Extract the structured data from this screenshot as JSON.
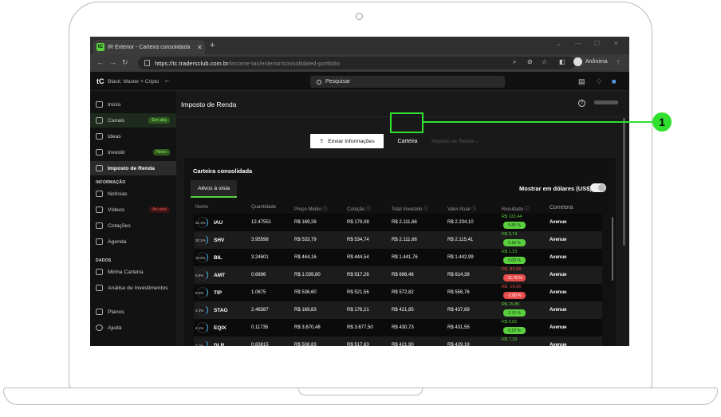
{
  "browser": {
    "tab_title": "IR Exterior - Carteira consolidada",
    "favicon_text": "tC",
    "url_host": "https://tc.tradersclub.com.br",
    "url_path": "/income-tax/exterior/consolidated-portfolio",
    "profile_label": "Anônima"
  },
  "app": {
    "logo": "tC",
    "plan": "Black: Master + Cripto",
    "search_placeholder": "Pesquisar",
    "page_title": "Imposto de Renda"
  },
  "sidebar": {
    "items": [
      {
        "label": "Início",
        "icon": "home-icon"
      },
      {
        "label": "Canais",
        "icon": "hash-icon",
        "badge": "Em alta"
      },
      {
        "label": "Ideas",
        "icon": "bulb-icon"
      },
      {
        "label": "Investir",
        "icon": "invest-icon",
        "badge": "Novo"
      },
      {
        "label": "Imposto de Renda",
        "icon": "tax-icon"
      }
    ],
    "section_informacao": "INFORMAÇÃO",
    "info_items": [
      {
        "label": "Notícias",
        "icon": "news-icon"
      },
      {
        "label": "Vídeos",
        "icon": "video-icon",
        "badge": "Ao vivo"
      },
      {
        "label": "Cotações",
        "icon": "quotes-icon"
      },
      {
        "label": "Agenda",
        "icon": "calendar-icon"
      }
    ],
    "section_dados": "DADOS",
    "data_items": [
      {
        "label": "Minha Carteira",
        "icon": "wallet-icon"
      },
      {
        "label": "Análise de Investimentos",
        "icon": "grid-icon"
      }
    ],
    "bottom_items": [
      {
        "label": "Planos",
        "icon": "cart-icon"
      },
      {
        "label": "Ajuda",
        "icon": "help-icon"
      }
    ]
  },
  "actions": {
    "enviar": "Enviar Informações",
    "carteira": "Carteira",
    "imposto_tab": "Imposto de Renda"
  },
  "card": {
    "title": "Carteira consolidada",
    "subtab": "Ativos à vista",
    "toggle_label": "Mostrar em dólares (US$)"
  },
  "table": {
    "headers": [
      "Nome",
      "Quantidade",
      "Preço Médio ⓘ",
      "Cotação ⓘ",
      "Total Investido ⓘ",
      "Valor Atual ⓘ",
      "Resultado ⓘ",
      "Corretora"
    ],
    "rows": [
      {
        "pct": "21.4%",
        "ticker": "IAU",
        "qty": "12.47551",
        "pm": "R$ 169,26",
        "cot": "R$ 179,08",
        "inv": "R$ 2.111,66",
        "atual": "R$ 2.234,10",
        "res": "R$ 122,44",
        "resp": "5.80 %",
        "sign": "pos",
        "corr": "Avenue"
      },
      {
        "pct": "20.2%",
        "ticker": "SHV",
        "qty": "3.95598",
        "pm": "R$ 533,79",
        "cot": "R$ 534,74",
        "inv": "R$ 2.111,66",
        "atual": "R$ 2.115,41",
        "res": "R$ 3,74",
        "resp": "0.18 %",
        "sign": "pos",
        "corr": "Avenue"
      },
      {
        "pct": "13.8%",
        "ticker": "BIL",
        "qty": "3.24601",
        "pm": "R$ 444,16",
        "cot": "R$ 444,54",
        "inv": "R$ 1.441,76",
        "atual": "R$ 1.442,99",
        "res": "R$ 1,23",
        "resp": "0.09 %",
        "sign": "pos",
        "corr": "Avenue"
      },
      {
        "pct": "5.9%",
        "ticker": "AMT",
        "qty": "0.6696",
        "pm": "R$ 1.039,80",
        "cot": "R$ 917,26",
        "inv": "R$ 696,46",
        "atual": "R$ 614,38",
        "res": "R$ -82,08",
        "resp": "-11.78 %",
        "sign": "neg",
        "corr": "Avenue"
      },
      {
        "pct": "5.3%",
        "ticker": "TIP",
        "qty": "1.0675",
        "pm": "R$ 536,60",
        "cot": "R$ 521,56",
        "inv": "R$ 572,82",
        "atual": "R$ 556,76",
        "res": "R$ -16,06",
        "resp": "-2.80 %",
        "sign": "neg",
        "corr": "Avenue"
      },
      {
        "pct": "4.2%",
        "ticker": "STAG",
        "qty": "2.48387",
        "pm": "R$ 169,83",
        "cot": "R$ 176,21",
        "inv": "R$ 421,85",
        "atual": "R$ 437,69",
        "res": "R$ 15,85",
        "resp": "3.76 %",
        "sign": "pos",
        "corr": "Avenue"
      },
      {
        "pct": "4.1%",
        "ticker": "EQIX",
        "qty": "0.11735",
        "pm": "R$ 3.670,48",
        "cot": "R$ 3.677,50",
        "inv": "R$ 430,73",
        "atual": "R$ 431,55",
        "res": "R$ 0,82",
        "resp": "0.19 %",
        "sign": "pos",
        "corr": "Avenue"
      },
      {
        "pct": "4.1%",
        "ticker": "DLR",
        "qty": "0.83815",
        "pm": "R$ 508,83",
        "cot": "R$ 517,63",
        "inv": "R$ 421,90",
        "atual": "R$ 429,19",
        "res": "R$ 7,29",
        "resp": "",
        "sign": "pos",
        "corr": "Avenue"
      }
    ]
  },
  "annotation": {
    "number": "1"
  },
  "colors": {
    "accent": "#5ad03e",
    "highlight": "#2fe02f",
    "negative": "#e84c4c"
  }
}
